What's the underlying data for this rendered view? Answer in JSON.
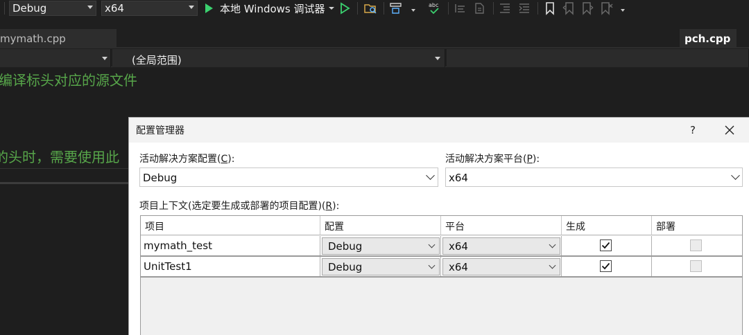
{
  "toolbar": {
    "config": "Debug",
    "platform": "x64",
    "run_label": "本地 Windows 调试器"
  },
  "tabs": {
    "left": "mymath.cpp",
    "right": "pch.cpp"
  },
  "navbar": {
    "scope": "(全局范围)"
  },
  "editor": {
    "line1": "编译标头对应的源文件",
    "line2": "的头时，需要使用此"
  },
  "dialog": {
    "title": "配置管理器",
    "help": "?",
    "active_config_label_pre": "活动解决方案配置(",
    "active_config_key": "C",
    "active_config_label_post": "):",
    "active_config_value": "Debug",
    "active_platform_label_pre": "活动解决方案平台(",
    "active_platform_key": "P",
    "active_platform_label_post": "):",
    "active_platform_value": "x64",
    "contexts_label_pre": "项目上下文(选定要生成或部署的项目配置)(",
    "contexts_key": "R",
    "contexts_label_post": "):",
    "columns": [
      "项目",
      "配置",
      "平台",
      "生成",
      "部署"
    ],
    "rows": [
      {
        "project": "mymath_test",
        "config": "Debug",
        "platform": "x64",
        "build": true,
        "deploy": false
      },
      {
        "project": "UnitTest1",
        "config": "Debug",
        "platform": "x64",
        "build": true,
        "deploy": false
      }
    ]
  }
}
